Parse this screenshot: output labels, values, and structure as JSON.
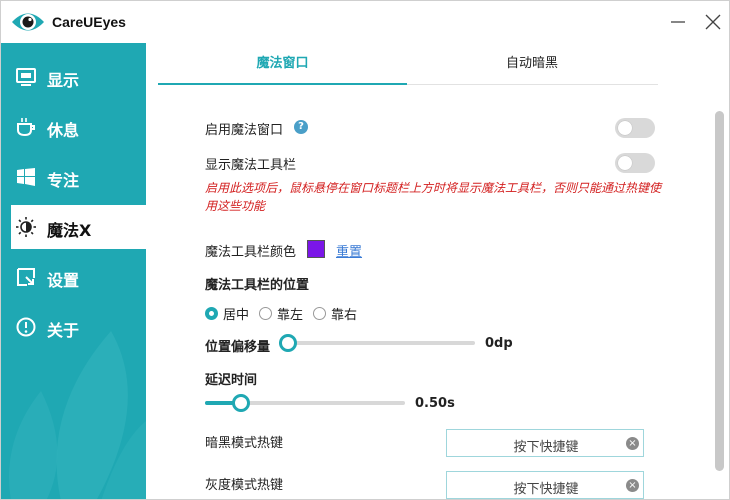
{
  "app": {
    "title": "CareUEyes"
  },
  "sidebar": {
    "items": [
      {
        "label": "显示",
        "icon": "monitor-icon"
      },
      {
        "label": "休息",
        "icon": "coffee-cup-icon"
      },
      {
        "label": "专注",
        "icon": "windows-icon"
      },
      {
        "label": "魔法X",
        "icon": "sun-moon-icon",
        "active": true
      },
      {
        "label": "设置",
        "icon": "settings-icon"
      },
      {
        "label": "关于",
        "icon": "info-icon"
      }
    ]
  },
  "tabs": [
    {
      "label": "魔法窗口",
      "active": true
    },
    {
      "label": "自动暗黑",
      "active": false
    }
  ],
  "settings": {
    "enable_magic_window": {
      "label": "启用魔法窗口",
      "help_icon": "?",
      "on": false
    },
    "show_magic_toolbar": {
      "label": "显示魔法工具栏",
      "on": false
    },
    "note": "启用此选项后，鼠标悬停在窗口标题栏上方时将显示魔法工具栏，否则只能通过热键使用这些功能",
    "toolbar_color": {
      "label": "魔法工具栏颜色",
      "color": "#7b16e8",
      "reset_label": "重置"
    },
    "toolbar_position": {
      "label": "魔法工具栏的位置",
      "options": [
        "居中",
        "靠左",
        "靠右"
      ],
      "selected": "居中"
    },
    "position_offset": {
      "label": "位置偏移量",
      "value": "0dp",
      "fraction": 0.0
    },
    "delay": {
      "label": "延迟时间",
      "value": "0.50s",
      "fraction": 0.15
    },
    "dark_hotkey": {
      "label": "暗黑模式热键",
      "placeholder": "按下快捷键"
    },
    "gray_hotkey": {
      "label": "灰度模式热键",
      "placeholder": "按下快捷键"
    }
  },
  "colors": {
    "accent": "#1fa8b3",
    "warning_text": "#d32020",
    "link": "#3a7bd5"
  }
}
